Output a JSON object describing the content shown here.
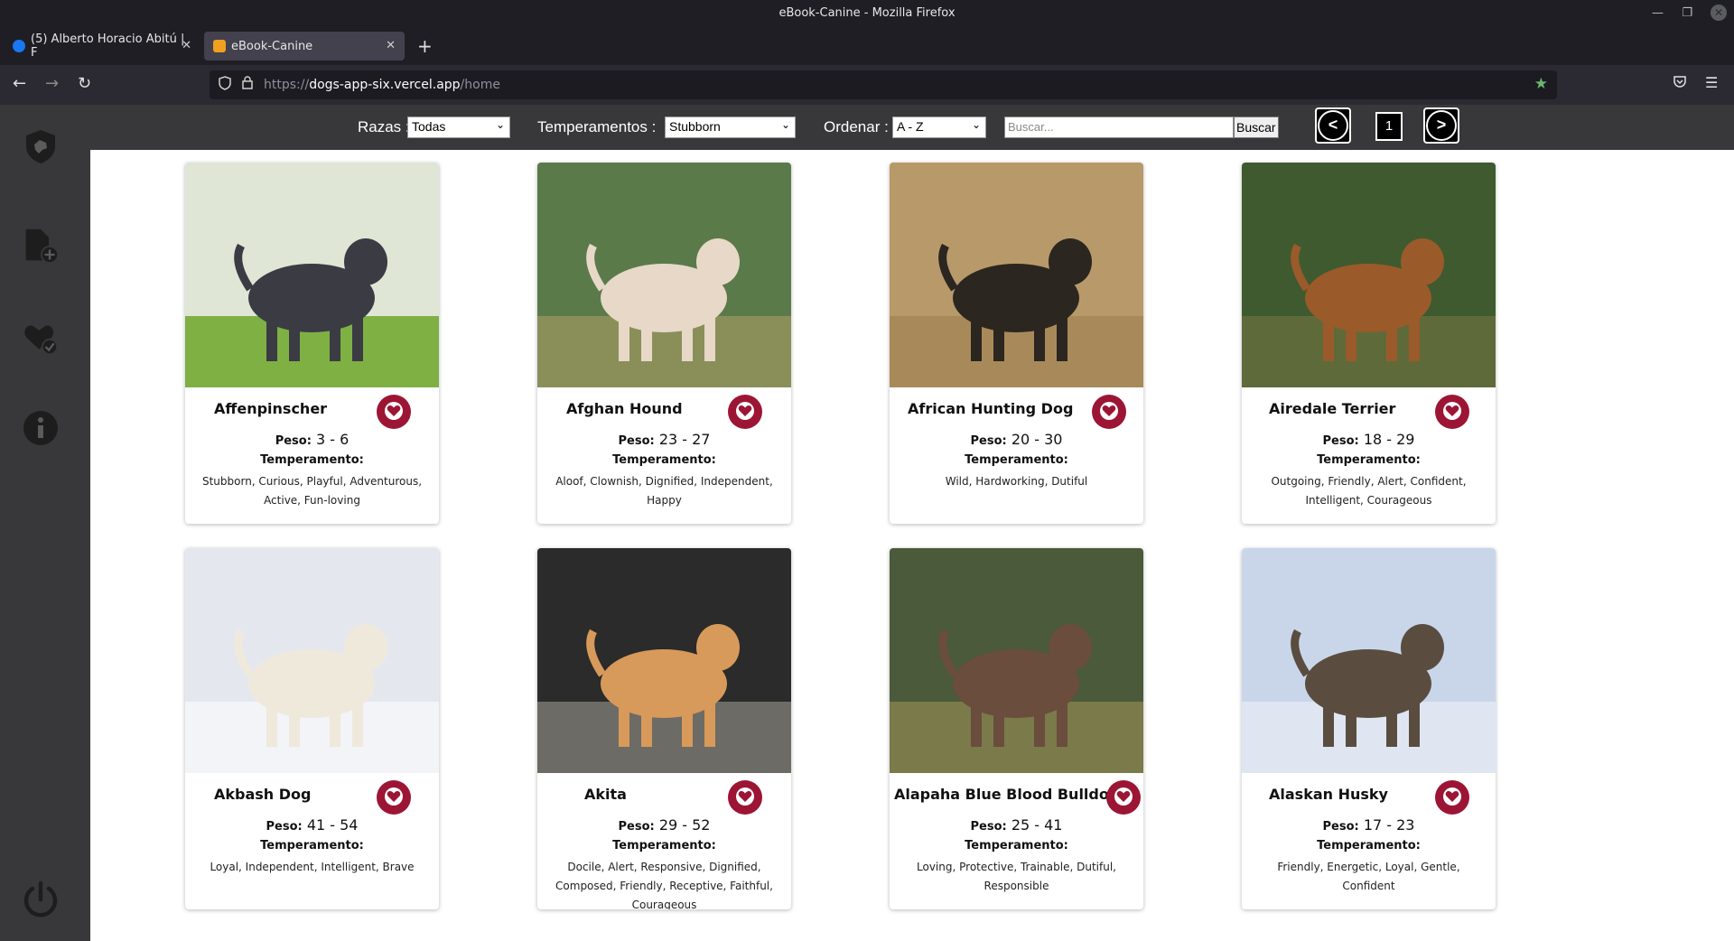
{
  "window": {
    "title": "eBook-Canine - Mozilla Firefox"
  },
  "tabs": [
    {
      "label": "(5) Alberto Horacio Abitú | F",
      "active": false,
      "favicon_color": "#1877f2"
    },
    {
      "label": "eBook-Canine",
      "active": true,
      "favicon_color": "#f0a020"
    }
  ],
  "address": {
    "protocol": "https://",
    "host": "dogs-app-six.vercel.app",
    "path": "/home"
  },
  "sidebar": {
    "items": [
      {
        "name": "dog-shield-icon"
      },
      {
        "name": "add-document-icon"
      },
      {
        "name": "favorite-heart-check-icon"
      },
      {
        "name": "info-icon"
      },
      {
        "name": "power-icon"
      }
    ]
  },
  "filters": {
    "razas_label": "Razas :",
    "razas_value": "Todas",
    "temperamentos_label": "Temperamentos :",
    "temperamentos_value": "Stubborn",
    "ordenar_label": "Ordenar :",
    "ordenar_value": "A - Z",
    "search_placeholder": "Buscar...",
    "search_button": "Buscar",
    "prev_glyph": "<",
    "next_glyph": ">",
    "page_number": "1"
  },
  "labels": {
    "peso": "Peso:",
    "temperamento": "Temperamento:"
  },
  "colors": {
    "heart_bg": "#9c1535",
    "sidebar_bg": "#38383a",
    "topbar_bg": "#38383a"
  },
  "dogs": [
    {
      "name": "Affenpinscher",
      "peso": "3 - 6",
      "temperament": "Stubborn, Curious, Playful, Adventurous, Active, Fun-loving",
      "photo": {
        "sky": "#dfe6d5",
        "ground": "#7fb044",
        "dog": "#3b3b44"
      }
    },
    {
      "name": "Afghan Hound",
      "peso": "23 - 27",
      "temperament": "Aloof, Clownish, Dignified, Independent, Happy",
      "photo": {
        "sky": "#5a7a4a",
        "ground": "#8a8f5a",
        "dog": "#e8d8c8"
      }
    },
    {
      "name": "African Hunting Dog",
      "peso": "20 - 30",
      "temperament": "Wild, Hardworking, Dutiful",
      "photo": {
        "sky": "#b89a6a",
        "ground": "#a88a5a",
        "dog": "#2b2620"
      }
    },
    {
      "name": "Airedale Terrier",
      "peso": "18 - 29",
      "temperament": "Outgoing, Friendly, Alert, Confident, Intelligent, Courageous",
      "photo": {
        "sky": "#3f5a2f",
        "ground": "#5f6a3a",
        "dog": "#9a5a2a"
      }
    },
    {
      "name": "Akbash Dog",
      "peso": "41 - 54",
      "temperament": "Loyal, Independent, Intelligent, Brave",
      "photo": {
        "sky": "#e4e8ee",
        "ground": "#f2f4f7",
        "dog": "#efe9dc"
      }
    },
    {
      "name": "Akita",
      "peso": "29 - 52",
      "temperament": "Docile, Alert, Responsive, Dignified, Composed, Friendly, Receptive, Faithful, Courageous",
      "photo": {
        "sky": "#2a2b2a",
        "ground": "#6d6b66",
        "dog": "#d79a5a"
      }
    },
    {
      "name": "Alapaha Blue Blood Bulldog",
      "peso": "25 - 41",
      "temperament": "Loving, Protective, Trainable, Dutiful, Responsible",
      "photo": {
        "sky": "#4a5a3a",
        "ground": "#7a7a4a",
        "dog": "#6a4d3d"
      }
    },
    {
      "name": "Alaskan Husky",
      "peso": "17 - 23",
      "temperament": "Friendly, Energetic, Loyal, Gentle, Confident",
      "photo": {
        "sky": "#c9d6ea",
        "ground": "#dfe6f2",
        "dog": "#5a4d40"
      }
    }
  ]
}
